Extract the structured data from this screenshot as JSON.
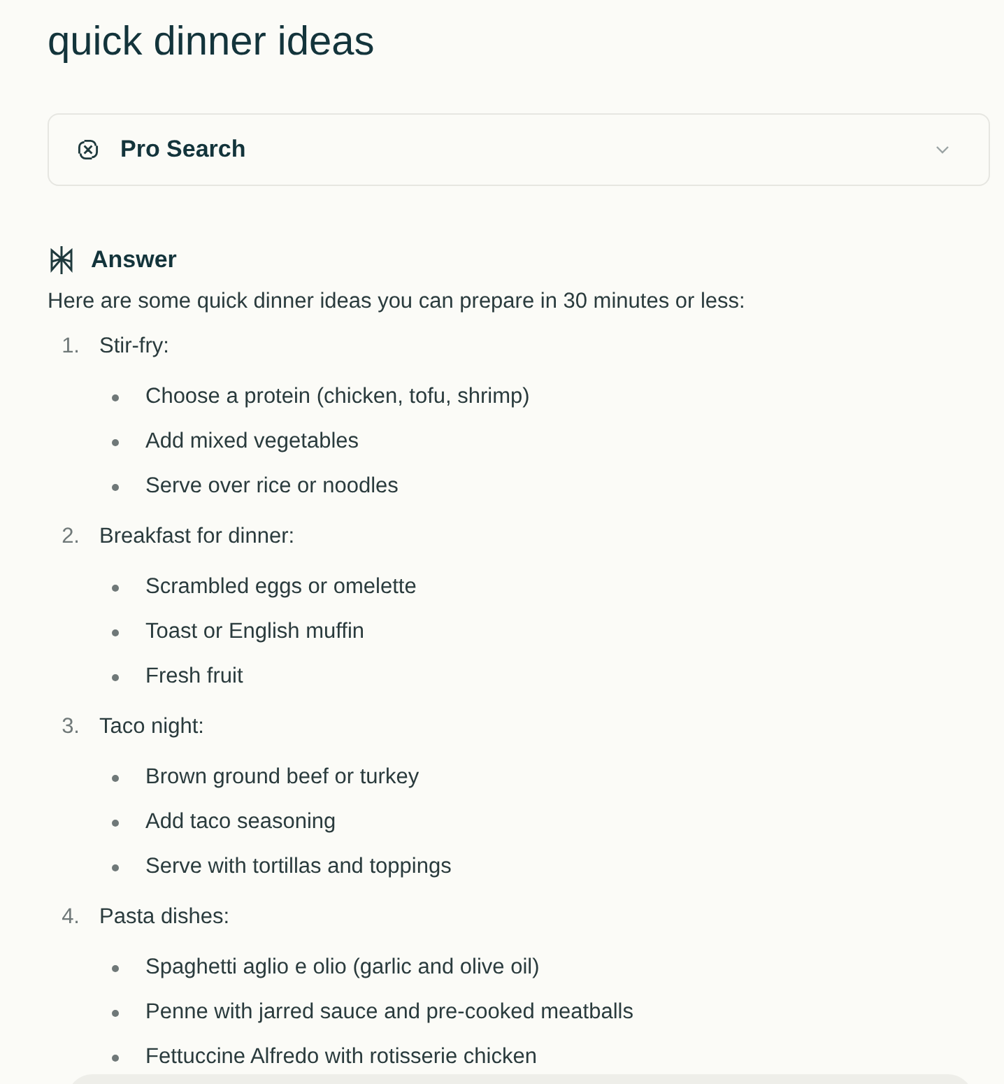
{
  "title": "quick dinner ideas",
  "pro_search": {
    "label": "Pro Search",
    "expanded": false
  },
  "answer": {
    "heading": "Answer",
    "intro": "Here are some quick dinner ideas you can prepare in 30 minutes or less:",
    "items": [
      {
        "number": "1.",
        "label": "Stir-fry:",
        "bullets": [
          "Choose a protein (chicken, tofu, shrimp)",
          "Add mixed vegetables",
          "Serve over rice or noodles"
        ]
      },
      {
        "number": "2.",
        "label": "Breakfast for dinner:",
        "bullets": [
          "Scrambled eggs or omelette",
          "Toast or English muffin",
          "Fresh fruit"
        ]
      },
      {
        "number": "3.",
        "label": "Taco night:",
        "bullets": [
          "Brown ground beef or turkey",
          "Add taco seasoning",
          "Serve with tortillas and toppings"
        ]
      },
      {
        "number": "4.",
        "label": "Pasta dishes:",
        "bullets": [
          "Spaghetti aglio e olio (garlic and olive oil)",
          "Penne with jarred sauce and pre-cooked meatballs",
          "Fettuccine Alfredo with rotisserie chicken"
        ]
      }
    ]
  }
}
